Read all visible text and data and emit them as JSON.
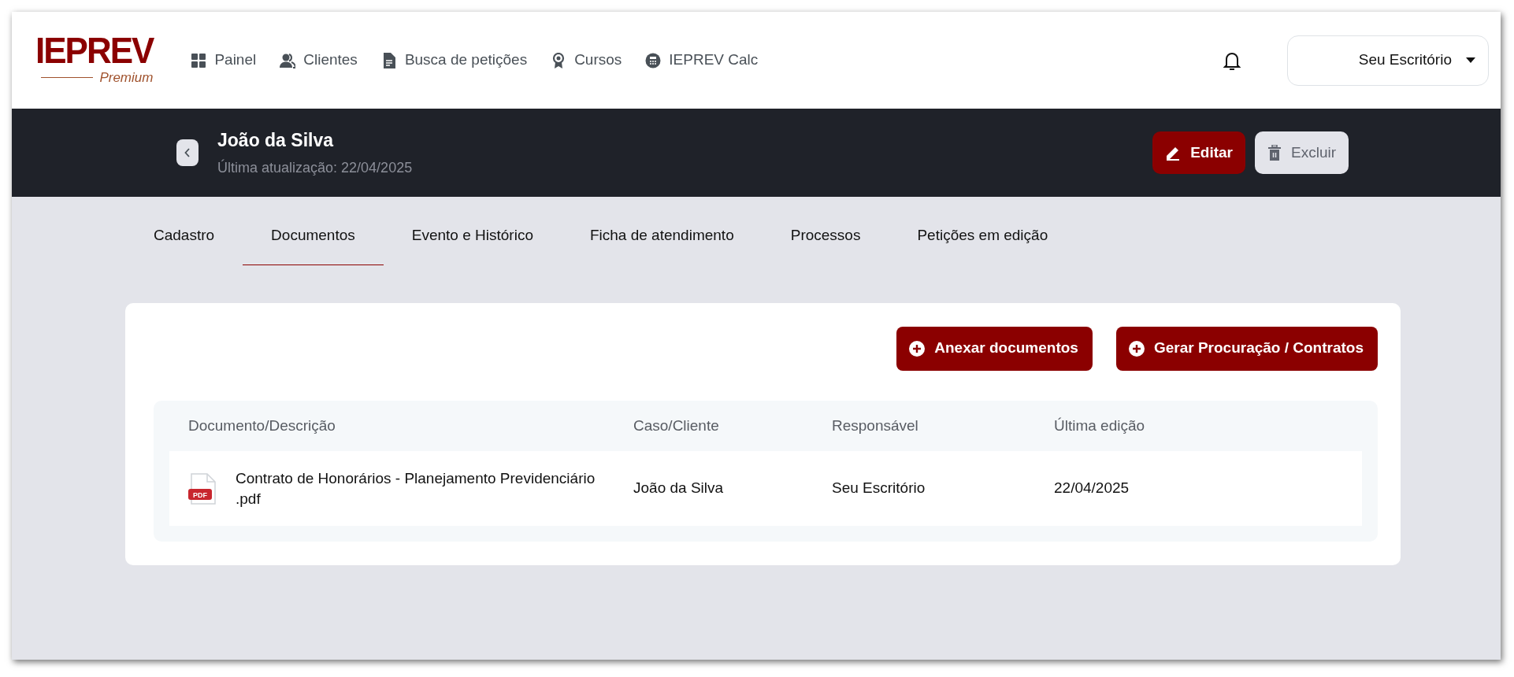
{
  "logo": {
    "title": "IEPREV",
    "subtitle": "Premium"
  },
  "nav": [
    {
      "label": "Painel",
      "kind": "grid"
    },
    {
      "label": "Clientes",
      "kind": "users"
    },
    {
      "label": "Busca de petições",
      "kind": "file"
    },
    {
      "label": "Cursos",
      "kind": "award"
    },
    {
      "label": "IEPREV Calc",
      "kind": "calc"
    }
  ],
  "account": {
    "label": "Seu Escritório"
  },
  "client": {
    "name": "João da Silva",
    "updated": "Última atualização: 22/04/2025"
  },
  "actions": [
    {
      "label": "Editar",
      "kind": "edit"
    },
    {
      "label": "Excluir",
      "kind": "delete"
    }
  ],
  "tabs": [
    {
      "label": "Cadastro",
      "selected": false
    },
    {
      "label": "Documentos",
      "selected": true
    },
    {
      "label": "Evento e Histórico",
      "selected": false
    },
    {
      "label": "Ficha de atendimento",
      "selected": false
    },
    {
      "label": "Processos",
      "selected": false
    },
    {
      "label": "Petições em edição",
      "selected": false
    }
  ],
  "document_buttons": [
    {
      "label": "Anexar documentos"
    },
    {
      "label": "Gerar Procuração / Contratos"
    }
  ],
  "table": {
    "columns": [
      "Documento/Descrição",
      "Caso/Cliente",
      "Responsável",
      "Última edição"
    ],
    "rows": [
      {
        "file_badge": "PDF",
        "document": "Contrato de Honorários - Planejamento Previdenciário .pdf",
        "client": "João da Silva",
        "owner": "Seu Escritório",
        "edited": "22/04/2025"
      }
    ]
  }
}
